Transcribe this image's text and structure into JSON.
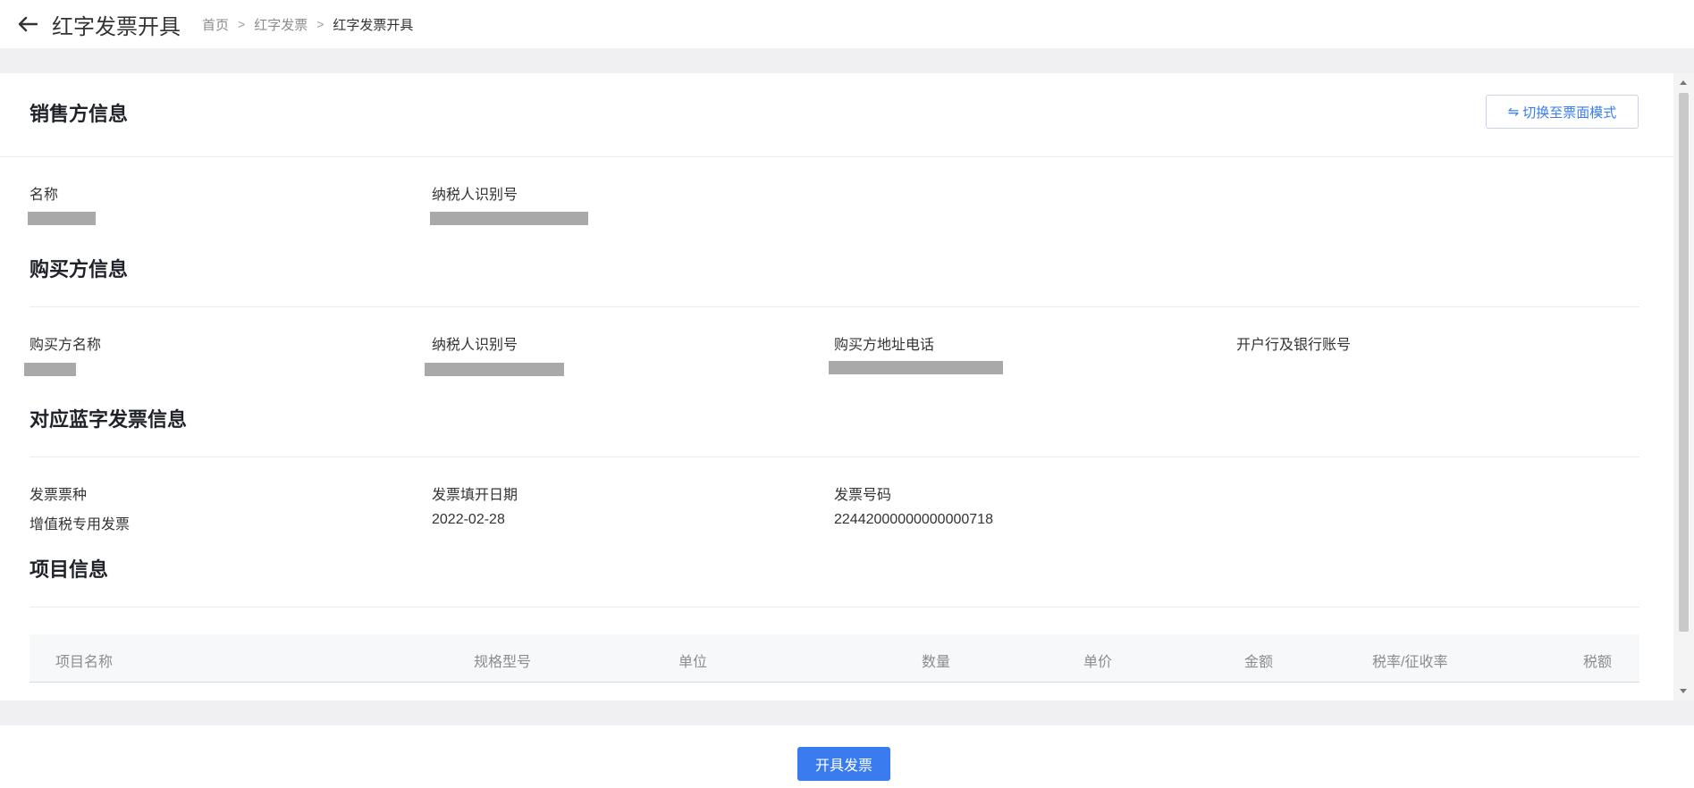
{
  "header": {
    "title": "红字发票开具",
    "breadcrumb": [
      "首页",
      "红字发票",
      "红字发票开具"
    ],
    "separator": ">"
  },
  "switch_button": {
    "label": "切换至票面模式",
    "icon": "swap-icon"
  },
  "seller": {
    "title": "销售方信息",
    "name_label": "名称",
    "tax_id_label": "纳税人识别号"
  },
  "buyer": {
    "title": "购买方信息",
    "name_label": "购买方名称",
    "tax_id_label": "纳税人识别号",
    "address_phone_label": "购买方地址电话",
    "bank_label": "开户行及银行账号"
  },
  "blue_invoice": {
    "title": "对应蓝字发票信息",
    "type_label": "发票票种",
    "type_value": "增值税专用发票",
    "date_label": "发票填开日期",
    "date_value": "2022-02-28",
    "number_label": "发票号码",
    "number_value": "22442000000000000718"
  },
  "items": {
    "title": "项目信息",
    "columns": [
      "项目名称",
      "规格型号",
      "单位",
      "数量",
      "单价",
      "金额",
      "税率/征收率",
      "税额"
    ]
  },
  "footer": {
    "submit_label": "开具发票"
  },
  "colors": {
    "accent": "#3a7cf0",
    "background": "#f0f0f2"
  }
}
